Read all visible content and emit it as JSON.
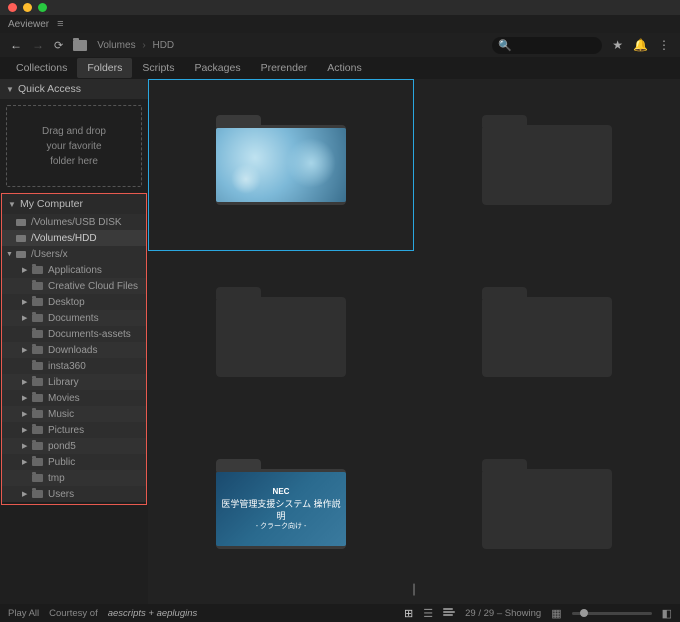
{
  "window": {
    "traffic": {
      "close": "#ff5f57",
      "min": "#febc2e",
      "max": "#28c840"
    },
    "app_name": "Aeviewer"
  },
  "toolbar": {
    "breadcrumb": {
      "root": "Volumes",
      "current": "HDD"
    },
    "search_placeholder": "🔍"
  },
  "tabs": {
    "items": [
      {
        "label": "Collections"
      },
      {
        "label": "Folders"
      },
      {
        "label": "Scripts"
      },
      {
        "label": "Packages"
      },
      {
        "label": "Prerender"
      },
      {
        "label": "Actions"
      }
    ],
    "active_index": 1
  },
  "sidebar": {
    "quick_access_label": "Quick Access",
    "drag_drop": {
      "line1": "Drag and drop",
      "line2": "your favorite",
      "line3": "folder here"
    },
    "my_computer_label": "My Computer",
    "volumes": [
      {
        "label": "/Volumes/USB DISK"
      },
      {
        "label": "/Volumes/HDD"
      }
    ],
    "user_root": {
      "label": "/Users/x"
    },
    "folders": [
      {
        "label": "Applications",
        "arrow": true
      },
      {
        "label": "Creative Cloud Files",
        "arrow": false
      },
      {
        "label": "Desktop",
        "arrow": true
      },
      {
        "label": "Documents",
        "arrow": true
      },
      {
        "label": "Documents-assets",
        "arrow": false
      },
      {
        "label": "Downloads",
        "arrow": true
      },
      {
        "label": "insta360",
        "arrow": false
      },
      {
        "label": "Library",
        "arrow": true
      },
      {
        "label": "Movies",
        "arrow": true
      },
      {
        "label": "Music",
        "arrow": true
      },
      {
        "label": "Pictures",
        "arrow": true
      },
      {
        "label": "pond5",
        "arrow": true
      },
      {
        "label": "Public",
        "arrow": true
      },
      {
        "label": "tmp",
        "arrow": false
      },
      {
        "label": "Users",
        "arrow": true
      }
    ]
  },
  "content": {
    "thumb_nec": {
      "brand": "NEC",
      "line1": "医学管理支援システム 操作説明",
      "line2": "- クラーク向け -"
    }
  },
  "statusbar": {
    "play_all": "Play All",
    "courtesy": "Courtesy of",
    "brand": "aescripts + aeplugins",
    "counter": "29 / 29 – Showing"
  }
}
